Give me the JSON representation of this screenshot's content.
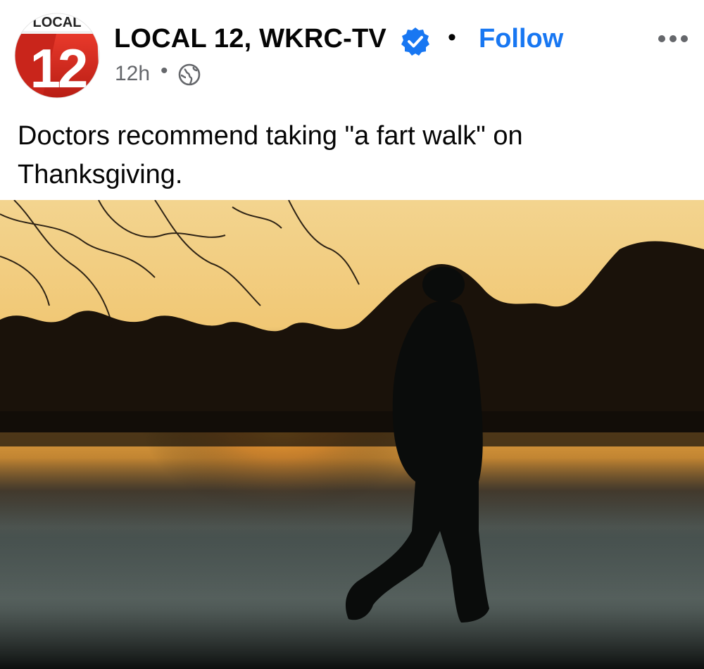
{
  "post": {
    "page_name": "LOCAL 12, WKRC-TV",
    "logo_text": "LOCAL 12",
    "separator": "•",
    "follow_label": "Follow",
    "time_ago": "12h",
    "time_separator": "•",
    "audience_icon": "globe-icon",
    "verified_icon": "verified-badge-icon",
    "more_icon": "more-options-icon",
    "caption": "Doctors recommend taking \"a fart walk\" on Thanksgiving."
  },
  "colors": {
    "link_blue": "#1877f2",
    "verified_blue": "#1877f2",
    "text_primary": "#050505",
    "text_secondary": "#65676b",
    "logo_red": "#d52b1e"
  }
}
